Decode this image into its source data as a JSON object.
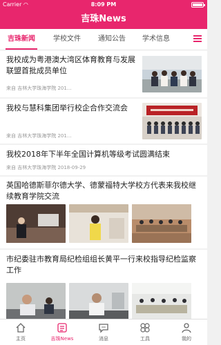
{
  "status_bar": {
    "carrier": "Carrier",
    "time": "8:09 PM"
  },
  "nav": {
    "title": "吉珠News"
  },
  "tabs": [
    {
      "label": "吉珠新闻",
      "active": true
    },
    {
      "label": "学校文件",
      "active": false
    },
    {
      "label": "通知公告",
      "active": false
    },
    {
      "label": "学术信息",
      "active": false
    }
  ],
  "menu_icon": "hamburger-icon",
  "feed": [
    {
      "title": "我校成为粤港澳大湾区体育教育与发展联盟首批成员单位",
      "meta": "来自 吉林大学珠海学院 201..."
    },
    {
      "title": "我校与慧科集团举行校企合作交流会",
      "meta": "来自 吉林大学珠海学院 201..."
    },
    {
      "title": "我校2018年下半年全国计算机等级考试圆满结束",
      "meta": "来自 吉林大学珠海学院  2018-09-29"
    },
    {
      "title": "英国哈德斯菲尔德大学、德蒙福特大学校方代表来我校继续教育学院交流",
      "meta": ""
    },
    {
      "title": "市纪委驻市教育局纪检组组长黄平一行来校指导纪检监察工作",
      "meta": ""
    }
  ],
  "tabbar": [
    {
      "label": "主页",
      "icon": "home-icon",
      "active": false
    },
    {
      "label": "吉珠News",
      "icon": "news-icon",
      "active": true
    },
    {
      "label": "消息",
      "icon": "message-icon",
      "active": false
    },
    {
      "label": "工具",
      "icon": "tools-icon",
      "active": false
    },
    {
      "label": "我的",
      "icon": "profile-icon",
      "active": false
    }
  ],
  "colors": {
    "accent": "#e8266d",
    "background": "#f1f1f1"
  }
}
